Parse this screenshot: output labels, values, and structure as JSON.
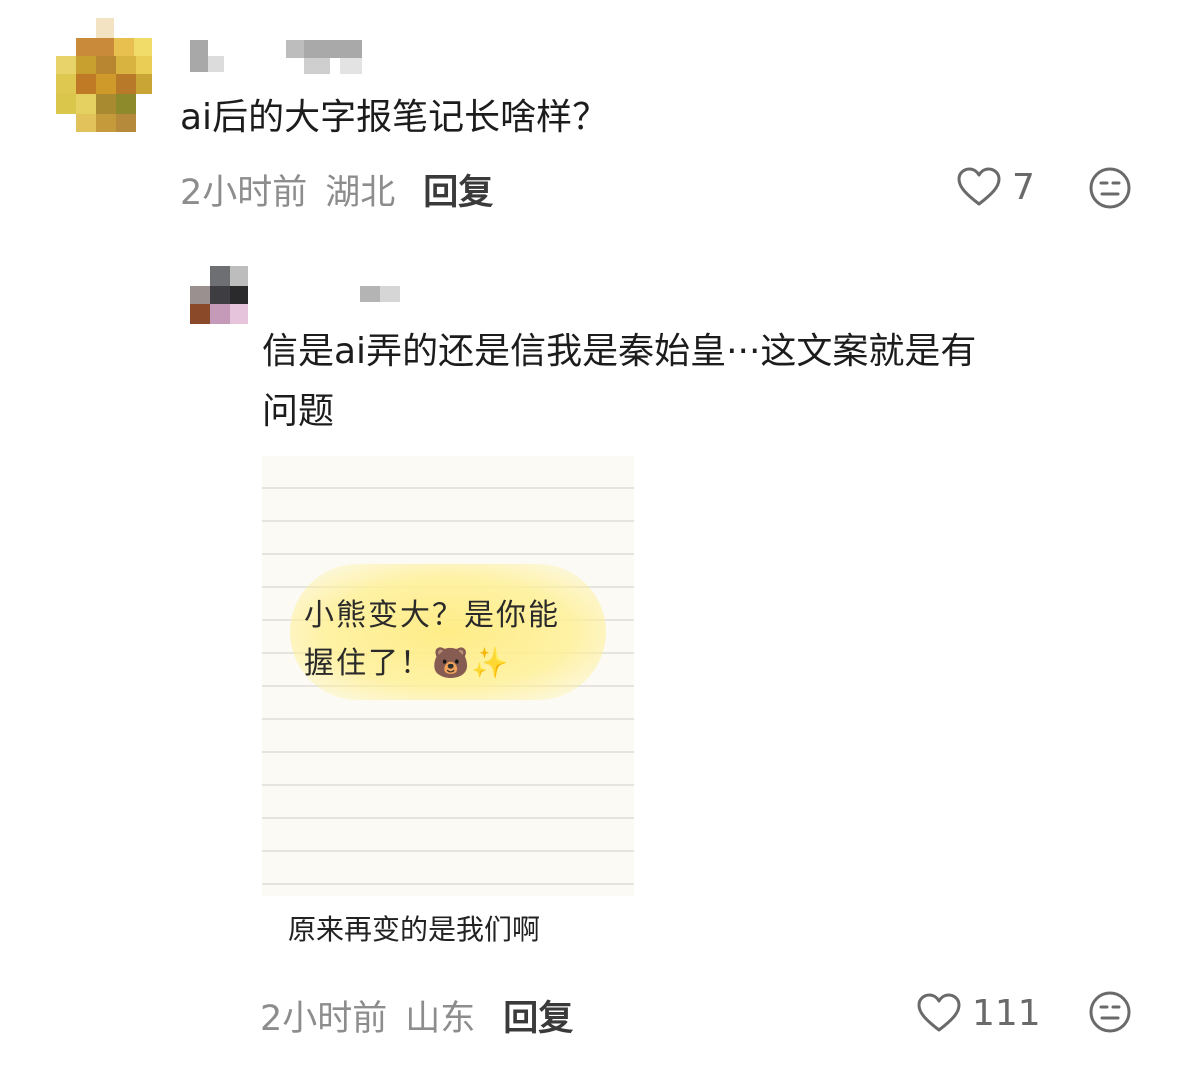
{
  "comments": [
    {
      "text": "ai后的大字报笔记长啥样？",
      "time": "2小时前",
      "location": "湖北",
      "reply_label": "回复",
      "like_count": "7"
    },
    {
      "text_line1": "信是ai弄的还是信我是秦始皇···这文案就是有",
      "text_line2": "问题",
      "image": {
        "handwriting_line1": "小熊变大？是你能",
        "handwriting_line2": "握住了！🐻✨",
        "caption": "原来再变的是我们啊"
      },
      "time": "2小时前",
      "location": "山东",
      "reply_label": "回复",
      "like_count": "111"
    }
  ],
  "colors": {
    "meta_gray": "#8d8d8d",
    "highlight_yellow": "#ffec82",
    "icon_gray": "#6a6a6a"
  },
  "icons": [
    "heart-outline-icon",
    "meh-face-icon"
  ]
}
